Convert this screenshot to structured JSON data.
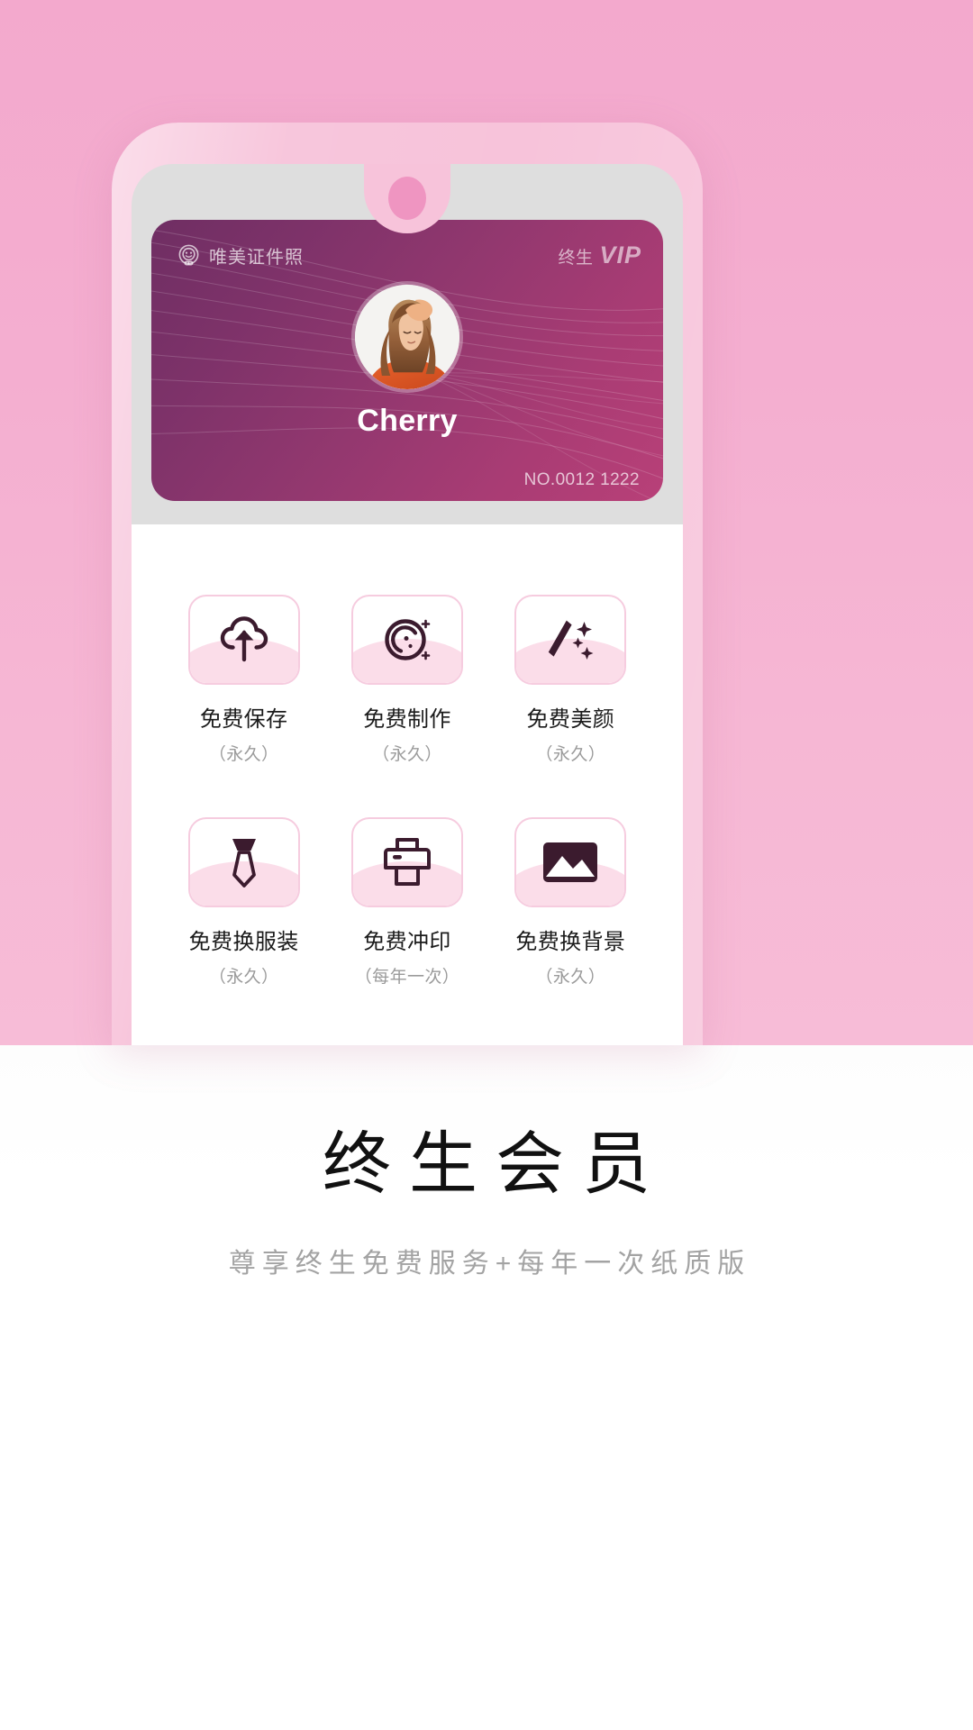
{
  "card": {
    "brand_name": "唯美证件照",
    "brand_logo_icon": "smiley-badge-icon",
    "vip_prefix": "终生",
    "vip_word": "VIP",
    "user_name": "Cherry",
    "serial_no": "NO.0012 1222",
    "avatar_icon": "user-photo-avatar",
    "gradient_from": "#6f2e63",
    "gradient_to": "#b84078"
  },
  "features": [
    {
      "icon": "cloud-upload-icon",
      "label": "免费保存",
      "sub": "（永久）"
    },
    {
      "icon": "retouch-circle-icon",
      "label": "免费制作",
      "sub": "（永久）"
    },
    {
      "icon": "magic-wand-icon",
      "label": "免费美颜",
      "sub": "（永久）"
    },
    {
      "icon": "necktie-icon",
      "label": "免费换服装",
      "sub": "（永久）"
    },
    {
      "icon": "printer-icon",
      "label": "免费冲印",
      "sub": "（每年一次）"
    },
    {
      "icon": "image-picture-icon",
      "label": "免费换背景",
      "sub": "（永久）"
    }
  ],
  "bottom": {
    "headline": "终生会员",
    "subline": "尊享终生免费服务+每年一次纸质版"
  },
  "theme": {
    "page_pink": "#f4aed0",
    "bezel_pink": "#f7c3da",
    "screen_grey": "#dedede",
    "camera_dot": "#ef95c1",
    "tile_border": "#f6ccdf",
    "tile_wave": "#fbdde9",
    "glyph_dark": "#3b1b2e",
    "label_dark": "#1b1b1b",
    "sub_grey": "#9b9b9b"
  }
}
